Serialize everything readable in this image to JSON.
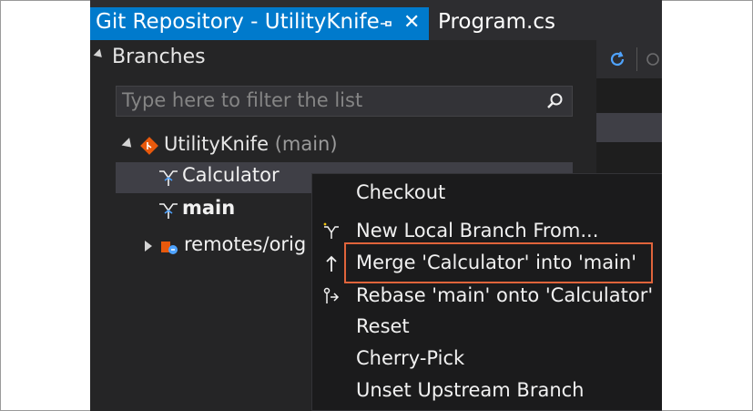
{
  "tabs": {
    "active": "Git Repository - UtilityKnife",
    "inactive": "Program.cs"
  },
  "section": {
    "title": "Branches"
  },
  "filter": {
    "placeholder": "Type here to filter the list"
  },
  "tree": {
    "repo_name": "UtilityKnife",
    "repo_branch": "(main)",
    "branches": [
      "Calculator",
      "main"
    ],
    "remotes_label": "remotes/orig"
  },
  "context_menu": {
    "items": [
      "Checkout",
      "New Local Branch From...",
      "Merge 'Calculator' into 'main'",
      "Rebase 'main' onto 'Calculator'",
      "Reset",
      "Cherry-Pick",
      "Unset Upstream Branch"
    ],
    "highlighted_index": 2,
    "highlight_color": "#e0643b"
  },
  "colors": {
    "accent": "#007acc",
    "git_orange": "#e8590c"
  },
  "icons": {
    "pin": "pin-icon",
    "close": "close-icon",
    "search": "search-icon",
    "branch": "branch-icon",
    "repo": "git-repo-icon",
    "remote": "remote-icon",
    "refresh": "refresh-icon"
  }
}
